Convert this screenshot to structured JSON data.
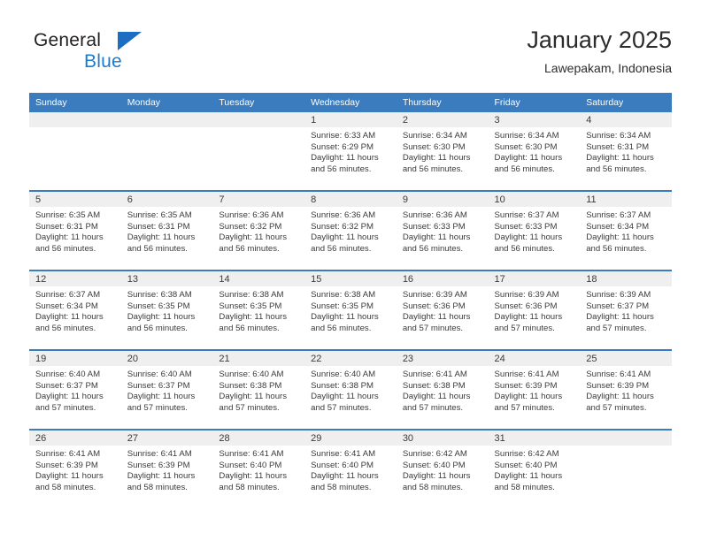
{
  "brand": {
    "name_top": "General",
    "name_bottom": "Blue",
    "triangle_color": "#1b6ec2",
    "blue_color": "#1b7bd0"
  },
  "header": {
    "title": "January 2025",
    "subtitle": "Lawepakam, Indonesia"
  },
  "theme": {
    "header_bg": "#3a7cbe",
    "header_text": "#ffffff",
    "row_divider": "#3a7cbe",
    "daynum_band": "#efefef",
    "body_text": "#3b3b3b"
  },
  "weekdays": [
    "Sunday",
    "Monday",
    "Tuesday",
    "Wednesday",
    "Thursday",
    "Friday",
    "Saturday"
  ],
  "labels": {
    "sunrise_prefix": "Sunrise:",
    "sunset_prefix": "Sunset:",
    "daylight_prefix": "Daylight:"
  },
  "weeks": [
    [
      {
        "empty": true
      },
      {
        "empty": true
      },
      {
        "empty": true
      },
      {
        "day": "1",
        "sunrise": "Sunrise: 6:33 AM",
        "sunset": "Sunset: 6:29 PM",
        "daylight1": "Daylight: 11 hours",
        "daylight2": "and 56 minutes."
      },
      {
        "day": "2",
        "sunrise": "Sunrise: 6:34 AM",
        "sunset": "Sunset: 6:30 PM",
        "daylight1": "Daylight: 11 hours",
        "daylight2": "and 56 minutes."
      },
      {
        "day": "3",
        "sunrise": "Sunrise: 6:34 AM",
        "sunset": "Sunset: 6:30 PM",
        "daylight1": "Daylight: 11 hours",
        "daylight2": "and 56 minutes."
      },
      {
        "day": "4",
        "sunrise": "Sunrise: 6:34 AM",
        "sunset": "Sunset: 6:31 PM",
        "daylight1": "Daylight: 11 hours",
        "daylight2": "and 56 minutes."
      }
    ],
    [
      {
        "day": "5",
        "sunrise": "Sunrise: 6:35 AM",
        "sunset": "Sunset: 6:31 PM",
        "daylight1": "Daylight: 11 hours",
        "daylight2": "and 56 minutes."
      },
      {
        "day": "6",
        "sunrise": "Sunrise: 6:35 AM",
        "sunset": "Sunset: 6:31 PM",
        "daylight1": "Daylight: 11 hours",
        "daylight2": "and 56 minutes."
      },
      {
        "day": "7",
        "sunrise": "Sunrise: 6:36 AM",
        "sunset": "Sunset: 6:32 PM",
        "daylight1": "Daylight: 11 hours",
        "daylight2": "and 56 minutes."
      },
      {
        "day": "8",
        "sunrise": "Sunrise: 6:36 AM",
        "sunset": "Sunset: 6:32 PM",
        "daylight1": "Daylight: 11 hours",
        "daylight2": "and 56 minutes."
      },
      {
        "day": "9",
        "sunrise": "Sunrise: 6:36 AM",
        "sunset": "Sunset: 6:33 PM",
        "daylight1": "Daylight: 11 hours",
        "daylight2": "and 56 minutes."
      },
      {
        "day": "10",
        "sunrise": "Sunrise: 6:37 AM",
        "sunset": "Sunset: 6:33 PM",
        "daylight1": "Daylight: 11 hours",
        "daylight2": "and 56 minutes."
      },
      {
        "day": "11",
        "sunrise": "Sunrise: 6:37 AM",
        "sunset": "Sunset: 6:34 PM",
        "daylight1": "Daylight: 11 hours",
        "daylight2": "and 56 minutes."
      }
    ],
    [
      {
        "day": "12",
        "sunrise": "Sunrise: 6:37 AM",
        "sunset": "Sunset: 6:34 PM",
        "daylight1": "Daylight: 11 hours",
        "daylight2": "and 56 minutes."
      },
      {
        "day": "13",
        "sunrise": "Sunrise: 6:38 AM",
        "sunset": "Sunset: 6:35 PM",
        "daylight1": "Daylight: 11 hours",
        "daylight2": "and 56 minutes."
      },
      {
        "day": "14",
        "sunrise": "Sunrise: 6:38 AM",
        "sunset": "Sunset: 6:35 PM",
        "daylight1": "Daylight: 11 hours",
        "daylight2": "and 56 minutes."
      },
      {
        "day": "15",
        "sunrise": "Sunrise: 6:38 AM",
        "sunset": "Sunset: 6:35 PM",
        "daylight1": "Daylight: 11 hours",
        "daylight2": "and 56 minutes."
      },
      {
        "day": "16",
        "sunrise": "Sunrise: 6:39 AM",
        "sunset": "Sunset: 6:36 PM",
        "daylight1": "Daylight: 11 hours",
        "daylight2": "and 57 minutes."
      },
      {
        "day": "17",
        "sunrise": "Sunrise: 6:39 AM",
        "sunset": "Sunset: 6:36 PM",
        "daylight1": "Daylight: 11 hours",
        "daylight2": "and 57 minutes."
      },
      {
        "day": "18",
        "sunrise": "Sunrise: 6:39 AM",
        "sunset": "Sunset: 6:37 PM",
        "daylight1": "Daylight: 11 hours",
        "daylight2": "and 57 minutes."
      }
    ],
    [
      {
        "day": "19",
        "sunrise": "Sunrise: 6:40 AM",
        "sunset": "Sunset: 6:37 PM",
        "daylight1": "Daylight: 11 hours",
        "daylight2": "and 57 minutes."
      },
      {
        "day": "20",
        "sunrise": "Sunrise: 6:40 AM",
        "sunset": "Sunset: 6:37 PM",
        "daylight1": "Daylight: 11 hours",
        "daylight2": "and 57 minutes."
      },
      {
        "day": "21",
        "sunrise": "Sunrise: 6:40 AM",
        "sunset": "Sunset: 6:38 PM",
        "daylight1": "Daylight: 11 hours",
        "daylight2": "and 57 minutes."
      },
      {
        "day": "22",
        "sunrise": "Sunrise: 6:40 AM",
        "sunset": "Sunset: 6:38 PM",
        "daylight1": "Daylight: 11 hours",
        "daylight2": "and 57 minutes."
      },
      {
        "day": "23",
        "sunrise": "Sunrise: 6:41 AM",
        "sunset": "Sunset: 6:38 PM",
        "daylight1": "Daylight: 11 hours",
        "daylight2": "and 57 minutes."
      },
      {
        "day": "24",
        "sunrise": "Sunrise: 6:41 AM",
        "sunset": "Sunset: 6:39 PM",
        "daylight1": "Daylight: 11 hours",
        "daylight2": "and 57 minutes."
      },
      {
        "day": "25",
        "sunrise": "Sunrise: 6:41 AM",
        "sunset": "Sunset: 6:39 PM",
        "daylight1": "Daylight: 11 hours",
        "daylight2": "and 57 minutes."
      }
    ],
    [
      {
        "day": "26",
        "sunrise": "Sunrise: 6:41 AM",
        "sunset": "Sunset: 6:39 PM",
        "daylight1": "Daylight: 11 hours",
        "daylight2": "and 58 minutes."
      },
      {
        "day": "27",
        "sunrise": "Sunrise: 6:41 AM",
        "sunset": "Sunset: 6:39 PM",
        "daylight1": "Daylight: 11 hours",
        "daylight2": "and 58 minutes."
      },
      {
        "day": "28",
        "sunrise": "Sunrise: 6:41 AM",
        "sunset": "Sunset: 6:40 PM",
        "daylight1": "Daylight: 11 hours",
        "daylight2": "and 58 minutes."
      },
      {
        "day": "29",
        "sunrise": "Sunrise: 6:41 AM",
        "sunset": "Sunset: 6:40 PM",
        "daylight1": "Daylight: 11 hours",
        "daylight2": "and 58 minutes."
      },
      {
        "day": "30",
        "sunrise": "Sunrise: 6:42 AM",
        "sunset": "Sunset: 6:40 PM",
        "daylight1": "Daylight: 11 hours",
        "daylight2": "and 58 minutes."
      },
      {
        "day": "31",
        "sunrise": "Sunrise: 6:42 AM",
        "sunset": "Sunset: 6:40 PM",
        "daylight1": "Daylight: 11 hours",
        "daylight2": "and 58 minutes."
      },
      {
        "empty": true
      }
    ]
  ]
}
